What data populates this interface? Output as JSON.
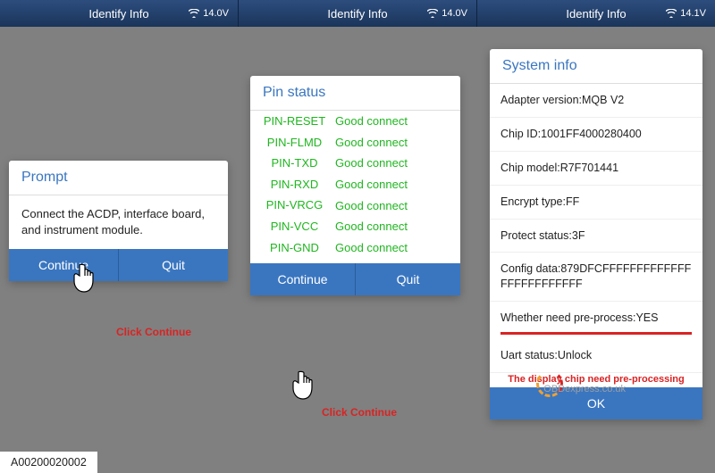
{
  "header": {
    "cells": [
      {
        "title": "Identify Info",
        "voltage": "14.0V"
      },
      {
        "title": "Identify Info",
        "voltage": "14.0V"
      },
      {
        "title": "Identify Info",
        "voltage": "14.1V"
      }
    ]
  },
  "prompt": {
    "title": "Prompt",
    "body": "Connect the ACDP, interface board, and instrument module.",
    "continue": "Continue",
    "quit": "Quit"
  },
  "pin": {
    "title": "Pin status",
    "rows": [
      {
        "name": "PIN-RESET",
        "status": "Good connect"
      },
      {
        "name": "PIN-FLMD",
        "status": "Good connect"
      },
      {
        "name": "PIN-TXD",
        "status": "Good connect"
      },
      {
        "name": "PIN-RXD",
        "status": "Good connect"
      },
      {
        "name": "PIN-VRCG",
        "status": "Good connect"
      },
      {
        "name": "PIN-VCC",
        "status": "Good connect"
      },
      {
        "name": "PIN-GND",
        "status": "Good connect"
      }
    ],
    "continue": "Continue",
    "quit": "Quit"
  },
  "sys": {
    "title": "System info",
    "rows": [
      "Adapter version:MQB V2",
      "Chip ID:1001FF4000280400",
      "Chip model:R7F701441",
      "Encrypt type:FF",
      "Protect status:3F",
      "Config data:879DFCFFFFFFFFFFFFFFFFFFFFFFFFF",
      "Whether need pre-process:YES",
      "Uart status:Unlock"
    ],
    "note": "The display chip need pre-processing",
    "ok": "OK"
  },
  "annotations": {
    "a1": "Click Continue",
    "a2": "Click Continue"
  },
  "bottom": "A00200020002",
  "watermark": "OBDexpress.co.uk"
}
